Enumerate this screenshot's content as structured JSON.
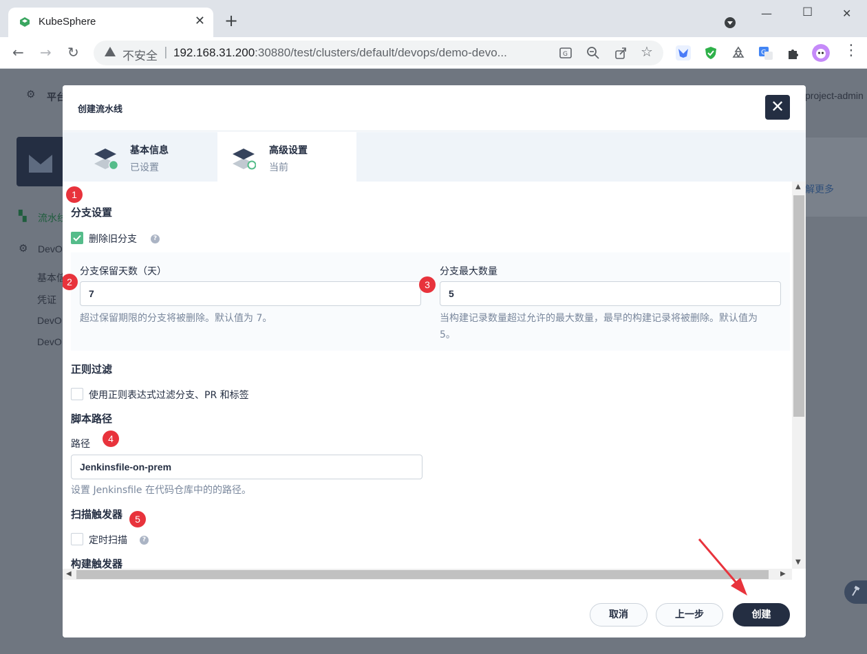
{
  "browser": {
    "tab_title": "KubeSphere",
    "insecure_label": "不安全",
    "url_host": "192.168.31.200",
    "url_rest": ":30880/test/clusters/default/devops/demo-devo..."
  },
  "background": {
    "platform_label": "平台",
    "user_label": "project-admin",
    "learn_more": "解更多",
    "nav_pipeline": "流水线",
    "nav_devops": "DevO",
    "sub_basic": "基本信",
    "sub_credentials": "凭证",
    "sub_devops1": "DevO",
    "sub_devops2": "DevO"
  },
  "modal": {
    "title": "创建流水线",
    "steps": [
      {
        "title": "基本信息",
        "status": "已设置"
      },
      {
        "title": "高级设置",
        "status": "当前"
      }
    ],
    "branch_settings": {
      "heading": "分支设置",
      "delete_old_label": "删除旧分支",
      "delete_old_checked": true,
      "retention_days_label": "分支保留天数（天）",
      "retention_days_value": "7",
      "retention_days_desc": "超过保留期限的分支将被删除。默认值为 7。",
      "max_branches_label": "分支最大数量",
      "max_branches_value": "5",
      "max_branches_desc_1": "当构建记录数量超过允许的最大数量，最早的构建记录将被删除。默认值为",
      "max_branches_desc_2": "5。"
    },
    "regex_filter": {
      "heading": "正则过滤",
      "checkbox_label": "使用正则表达式过滤分支、PR 和标签",
      "checked": false
    },
    "script_path": {
      "heading": "脚本路径",
      "field_label": "路径",
      "value": "Jenkinsfile-on-prem",
      "desc": "设置 Jenkinsfile 在代码仓库中的的路径。"
    },
    "scan_trigger": {
      "heading": "扫描触发器",
      "checkbox_label": "定时扫描",
      "checked": false
    },
    "build_trigger": {
      "heading": "构建触发器"
    },
    "annotations": [
      "1",
      "2",
      "3",
      "4",
      "5"
    ],
    "footer": {
      "cancel": "取消",
      "previous": "上一步",
      "create": "创建"
    }
  },
  "colors": {
    "primary": "#242e42",
    "success": "#55bc8a",
    "annotation": "#e8333c",
    "arrow": "#e8333c"
  }
}
